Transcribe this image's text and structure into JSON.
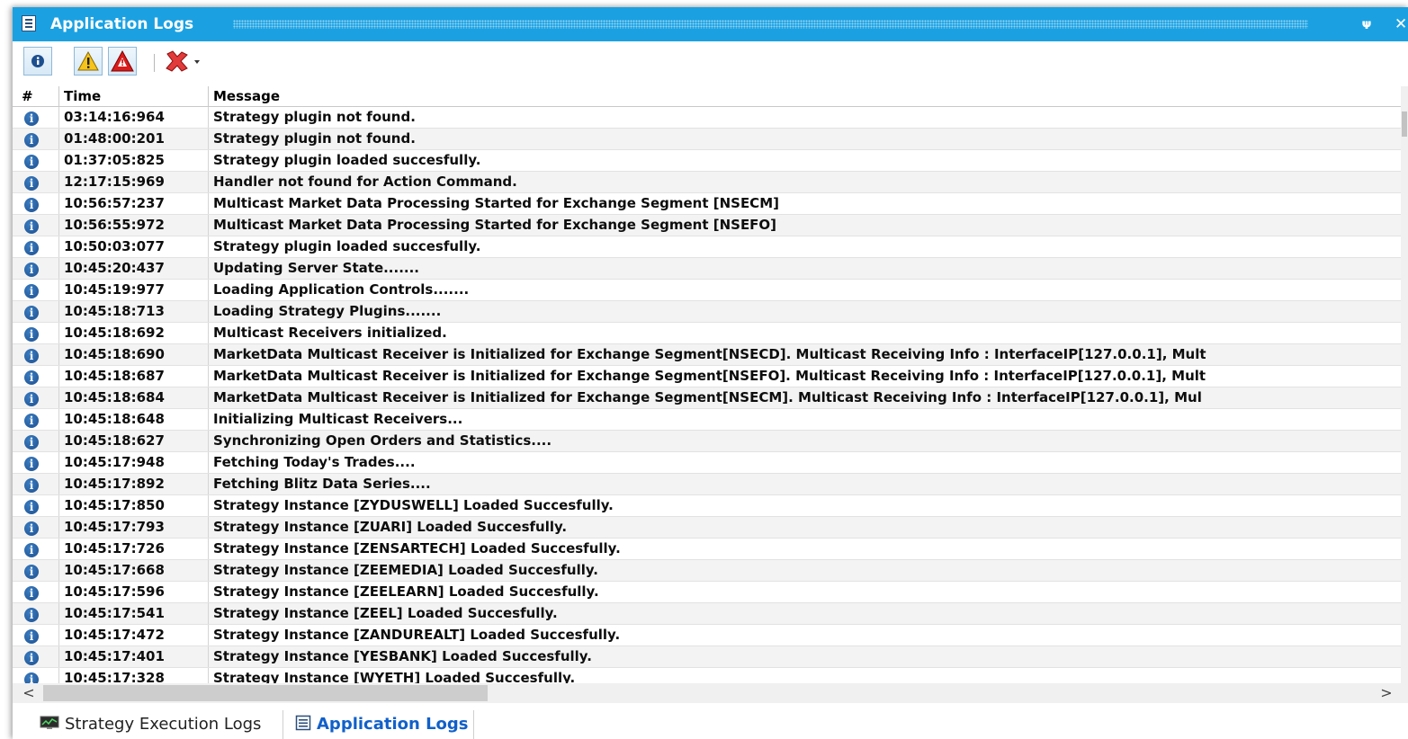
{
  "window": {
    "title": "Application Logs",
    "pin_glyph": "ᴪ",
    "close_glyph": "✕"
  },
  "toolbar": {
    "buttons": [
      {
        "name": "info-filter",
        "icon": "info-icon"
      },
      {
        "name": "warning-filter",
        "icon": "warning-icon"
      },
      {
        "name": "error-filter",
        "icon": "error-icon"
      },
      {
        "name": "clear-logs",
        "icon": "red-x-icon"
      }
    ]
  },
  "grid": {
    "columns": {
      "number": "#",
      "time": "Time",
      "message": "Message"
    },
    "rows": [
      {
        "time": "03:14:16:964",
        "message": "Strategy plugin not found."
      },
      {
        "time": "01:48:00:201",
        "message": "Strategy plugin not found."
      },
      {
        "time": "01:37:05:825",
        "message": "Strategy plugin loaded succesfully."
      },
      {
        "time": "12:17:15:969",
        "message": "Handler not found for Action Command."
      },
      {
        "time": "10:56:57:237",
        "message": "Multicast Market Data Processing Started for Exchange Segment [NSECM]"
      },
      {
        "time": "10:56:55:972",
        "message": "Multicast Market Data Processing Started for Exchange Segment [NSEFO]"
      },
      {
        "time": "10:50:03:077",
        "message": "Strategy plugin loaded succesfully."
      },
      {
        "time": "10:45:20:437",
        "message": "Updating Server State......."
      },
      {
        "time": "10:45:19:977",
        "message": "Loading Application Controls......."
      },
      {
        "time": "10:45:18:713",
        "message": "Loading Strategy Plugins......."
      },
      {
        "time": "10:45:18:692",
        "message": "Multicast Receivers initialized."
      },
      {
        "time": "10:45:18:690",
        "message": "MarketData Multicast Receiver is Initialized for Exchange Segment[NSECD]. Multicast Receiving Info : InterfaceIP[127.0.0.1], Mult"
      },
      {
        "time": "10:45:18:687",
        "message": "MarketData Multicast Receiver is Initialized for Exchange Segment[NSEFO]. Multicast Receiving Info : InterfaceIP[127.0.0.1], Mult"
      },
      {
        "time": "10:45:18:684",
        "message": "MarketData Multicast Receiver is Initialized for Exchange Segment[NSECM]. Multicast Receiving Info : InterfaceIP[127.0.0.1], Mul"
      },
      {
        "time": "10:45:18:648",
        "message": "Initializing Multicast Receivers..."
      },
      {
        "time": "10:45:18:627",
        "message": "Synchronizing Open Orders and Statistics...."
      },
      {
        "time": "10:45:17:948",
        "message": "Fetching Today's Trades...."
      },
      {
        "time": "10:45:17:892",
        "message": "Fetching Blitz Data Series...."
      },
      {
        "time": "10:45:17:850",
        "message": "Strategy Instance [ZYDUSWELL] Loaded Succesfully."
      },
      {
        "time": "10:45:17:793",
        "message": "Strategy Instance [ZUARI] Loaded Succesfully."
      },
      {
        "time": "10:45:17:726",
        "message": "Strategy Instance [ZENSARTECH] Loaded Succesfully."
      },
      {
        "time": "10:45:17:668",
        "message": "Strategy Instance [ZEEMEDIA] Loaded Succesfully."
      },
      {
        "time": "10:45:17:596",
        "message": "Strategy Instance [ZEELEARN] Loaded Succesfully."
      },
      {
        "time": "10:45:17:541",
        "message": "Strategy Instance [ZEEL] Loaded Succesfully."
      },
      {
        "time": "10:45:17:472",
        "message": "Strategy Instance [ZANDUREALT] Loaded Succesfully."
      },
      {
        "time": "10:45:17:401",
        "message": "Strategy Instance [YESBANK] Loaded Succesfully."
      },
      {
        "time": "10:45:17:328",
        "message": "Strategy Instance [WYETH] Loaded Succesfully."
      }
    ]
  },
  "scroll": {
    "left_arrow": "<",
    "right_arrow": ">"
  },
  "tabs": [
    {
      "label": "Strategy Execution Logs",
      "active": false
    },
    {
      "label": "Application Logs",
      "active": true
    }
  ],
  "colors": {
    "titlebar": "#1ba1e2",
    "active_tab": "#1160c9",
    "info_icon": "#1d4f8e"
  }
}
